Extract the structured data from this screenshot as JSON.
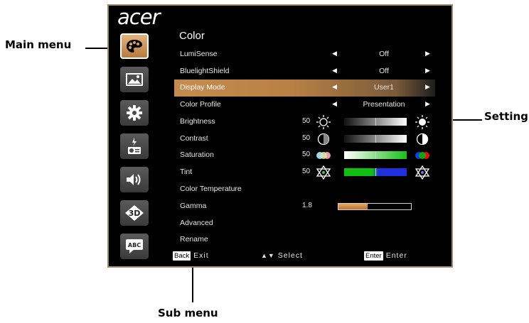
{
  "callouts": {
    "main_menu": "Main menu",
    "setting": "Setting",
    "sub_menu": "Sub menu"
  },
  "osd": {
    "logo": "acer",
    "title": "Color",
    "rows": [
      {
        "label": "LumiSense",
        "value": "Off"
      },
      {
        "label": "BluelightShield",
        "value": "Off"
      },
      {
        "label": "Display Mode",
        "value": "User1"
      },
      {
        "label": "Color Profile",
        "value": "Presentation"
      },
      {
        "label": "Brightness",
        "number": "50"
      },
      {
        "label": "Contrast",
        "number": "50"
      },
      {
        "label": "Saturation",
        "number": "50"
      },
      {
        "label": "Tint",
        "number": "50"
      },
      {
        "label": "Color Temperature"
      },
      {
        "label": "Gamma",
        "number": "1.8",
        "level": 0.4
      },
      {
        "label": "Advanced"
      },
      {
        "label": "Rename"
      }
    ],
    "footer": {
      "back_key": "Back",
      "back_label": "Exit",
      "select_label": "Select",
      "enter_key": "Enter",
      "enter_label": "Enter"
    },
    "side_menu": [
      {
        "icon": "palette-icon",
        "active": true
      },
      {
        "icon": "image-icon"
      },
      {
        "icon": "gear-icon"
      },
      {
        "icon": "projector-power-icon"
      },
      {
        "icon": "speaker-icon"
      },
      {
        "icon": "3d-icon",
        "text": "3D"
      },
      {
        "icon": "language-icon",
        "text": "ABC"
      }
    ],
    "accent_color": "#c58b4f"
  }
}
